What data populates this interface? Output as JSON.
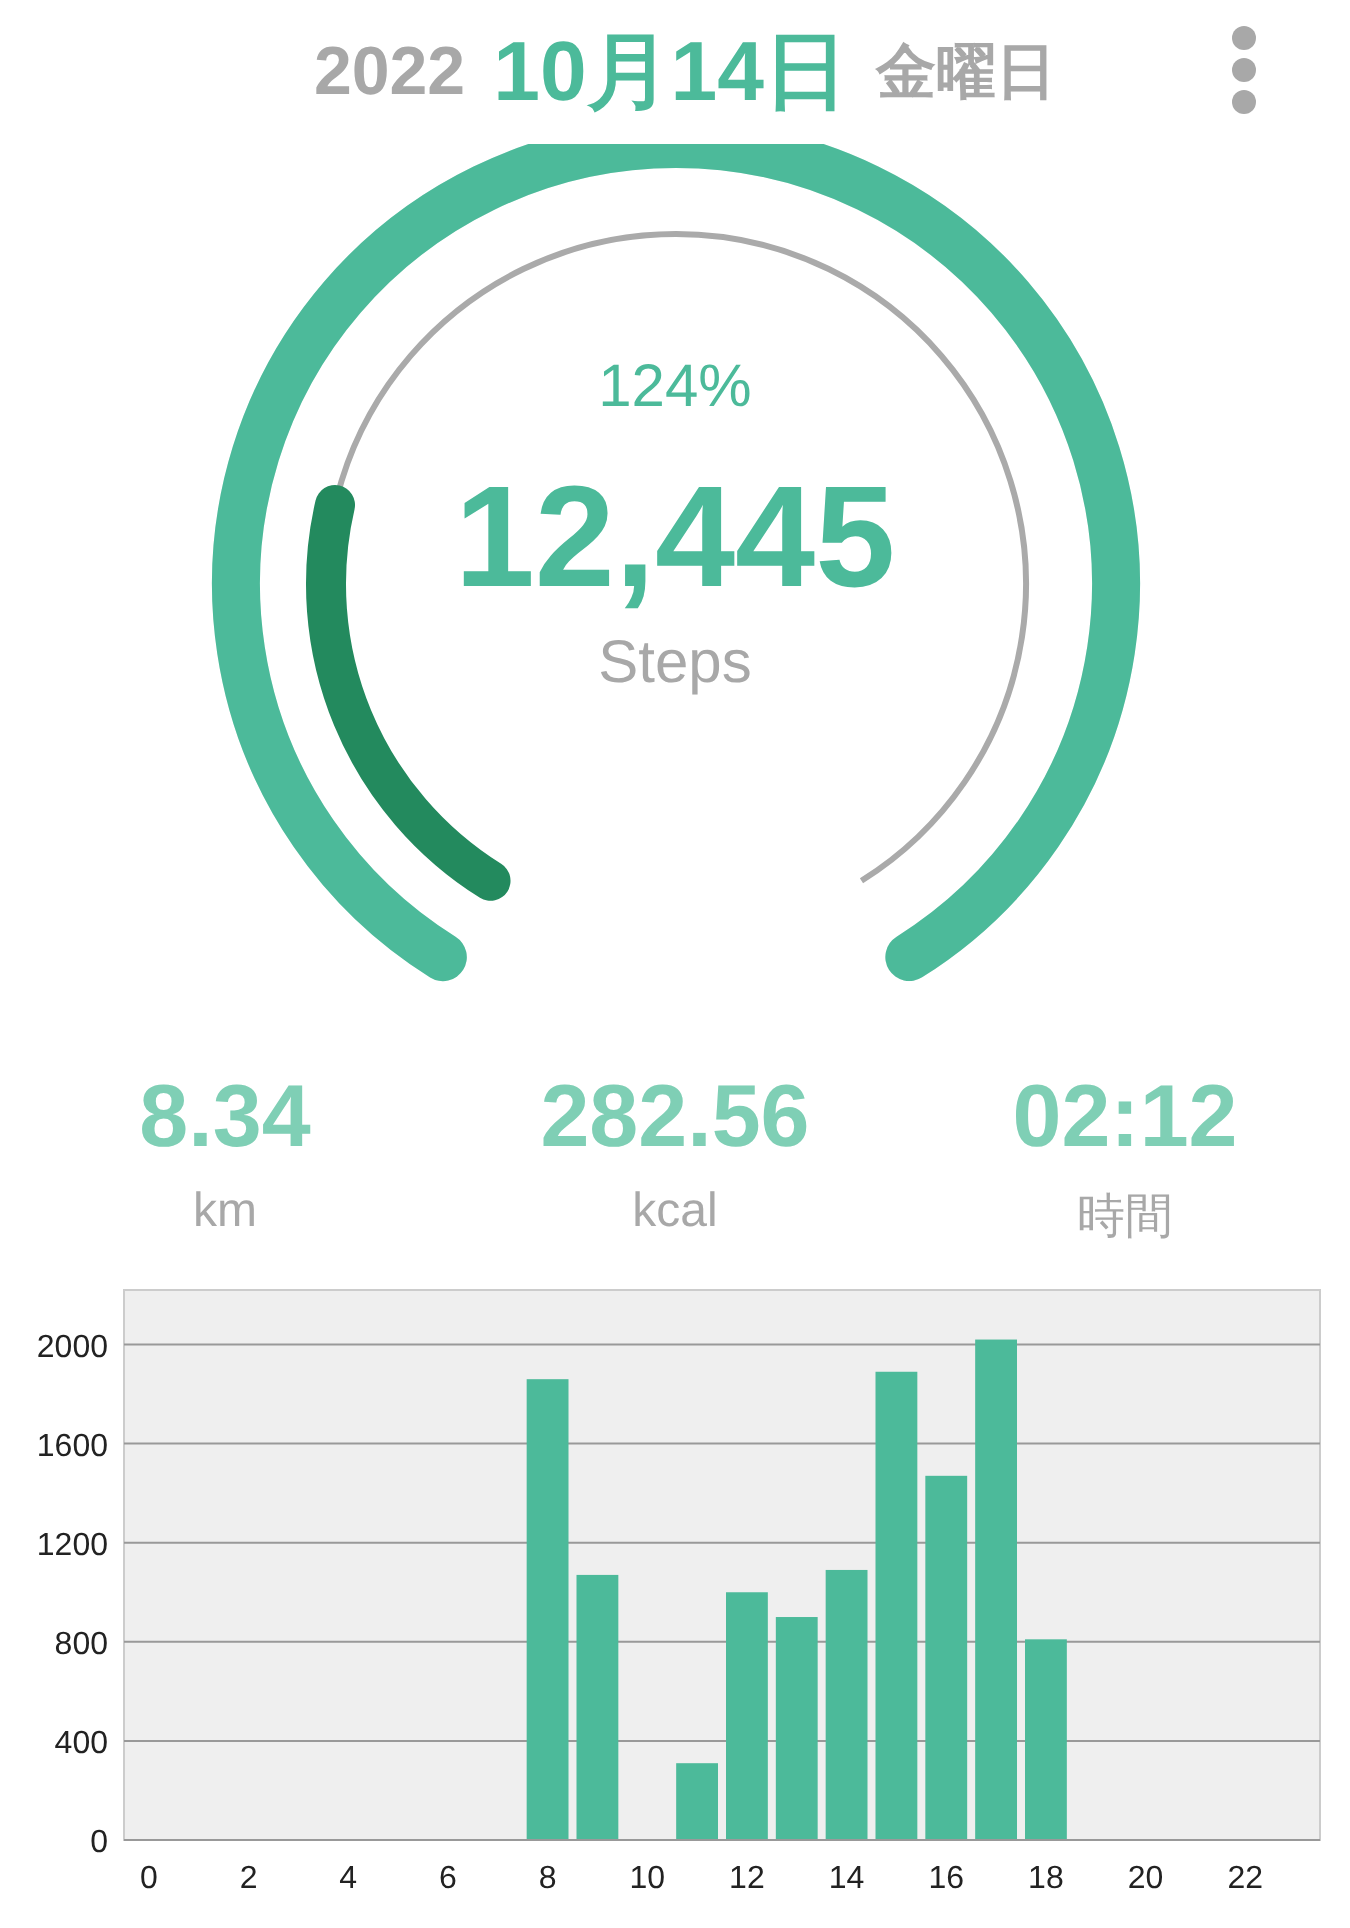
{
  "header": {
    "year": "2022",
    "date": "10月14日",
    "weekday": "金曜日"
  },
  "gauge": {
    "percent": "124%",
    "steps": "12,445",
    "unit": "Steps",
    "level": 1,
    "overflow": {
      "level": 0.24
    }
  },
  "stats": [
    {
      "value": "8.34",
      "unit": "km"
    },
    {
      "value": "282.56",
      "unit": "kcal"
    },
    {
      "value": "02:12",
      "unit": "時間"
    }
  ],
  "chart": {
    "chart_data": {
      "type": "bar",
      "x": [
        8,
        9,
        11,
        12,
        13,
        14,
        15,
        16,
        17,
        18
      ],
      "series": [
        {
          "color": "#4cba9a",
          "values": [
            1860,
            1070,
            310,
            1000,
            900,
            1090,
            1890,
            1470,
            2020,
            810
          ]
        }
      ],
      "xlim": [
        -0.5,
        23.5
      ],
      "ylim": [
        0,
        2220
      ],
      "yticks": [
        0,
        400,
        800,
        1200,
        1600,
        2000
      ],
      "xticks": [
        0,
        2,
        4,
        6,
        8,
        10,
        12,
        14,
        16,
        18,
        20,
        22
      ],
      "grid": true
    }
  }
}
